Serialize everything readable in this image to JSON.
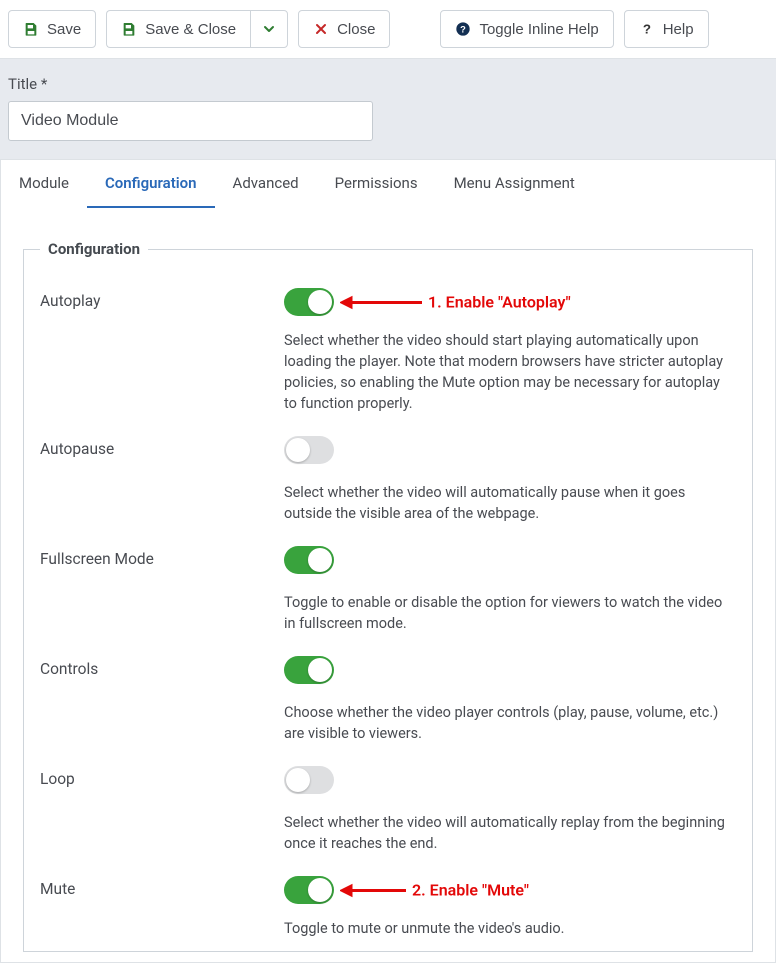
{
  "toolbar": {
    "save": "Save",
    "save_close": "Save & Close",
    "close": "Close",
    "toggle_help": "Toggle Inline Help",
    "help": "Help"
  },
  "title": {
    "label": "Title *",
    "value": "Video Module"
  },
  "tabs": {
    "module": "Module",
    "configuration": "Configuration",
    "advanced": "Advanced",
    "permissions": "Permissions",
    "menu_assignment": "Menu Assignment",
    "active": "configuration"
  },
  "fieldset": {
    "legend": "Configuration"
  },
  "options": {
    "autoplay": {
      "label": "Autoplay",
      "state": "on",
      "desc": "Select whether the video should start playing automatically upon loading the player. Note that modern browsers have stricter autoplay policies, so enabling the Mute option may be necessary for autoplay to function properly."
    },
    "autopause": {
      "label": "Autopause",
      "state": "off",
      "desc": "Select whether the video will automatically pause when it goes outside the visible area of the webpage."
    },
    "fullscreen": {
      "label": "Fullscreen Mode",
      "state": "on",
      "desc": "Toggle to enable or disable the option for viewers to watch the video in fullscreen mode."
    },
    "controls": {
      "label": "Controls",
      "state": "on",
      "desc": "Choose whether the video player controls (play, pause, volume, etc.) are visible to viewers."
    },
    "loop": {
      "label": "Loop",
      "state": "off",
      "desc": "Select whether the video will automatically replay from the beginning once it reaches the end."
    },
    "mute": {
      "label": "Mute",
      "state": "on",
      "desc": "Toggle to mute or unmute the video's audio."
    }
  },
  "annotations": {
    "autoplay": "1. Enable \"Autoplay\"",
    "mute": "2. Enable \"Mute\""
  }
}
